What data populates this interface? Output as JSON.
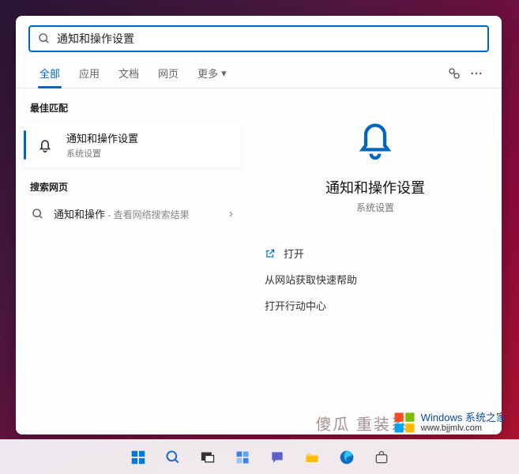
{
  "search": {
    "query": "通知和操作设置",
    "placeholder": ""
  },
  "tabs": {
    "all": "全部",
    "apps": "应用",
    "documents": "文档",
    "web": "网页",
    "more": "更多"
  },
  "left": {
    "best_match_label": "最佳匹配",
    "result": {
      "title": "通知和操作设置",
      "subtitle": "系统设置"
    },
    "search_web_label": "搜索网页",
    "web_item": {
      "prefix": "通知和操作",
      "suffix": " - 查看网络搜索结果"
    }
  },
  "preview": {
    "title": "通知和操作设置",
    "subtitle": "系统设置",
    "open": "打开",
    "help": "从网站获取快速帮助",
    "action_center": "打开行动中心"
  },
  "ghost": "傻瓜     重装系",
  "watermark": {
    "line1": "Windows 系统之家",
    "line2": "www.bjjmlv.com"
  }
}
